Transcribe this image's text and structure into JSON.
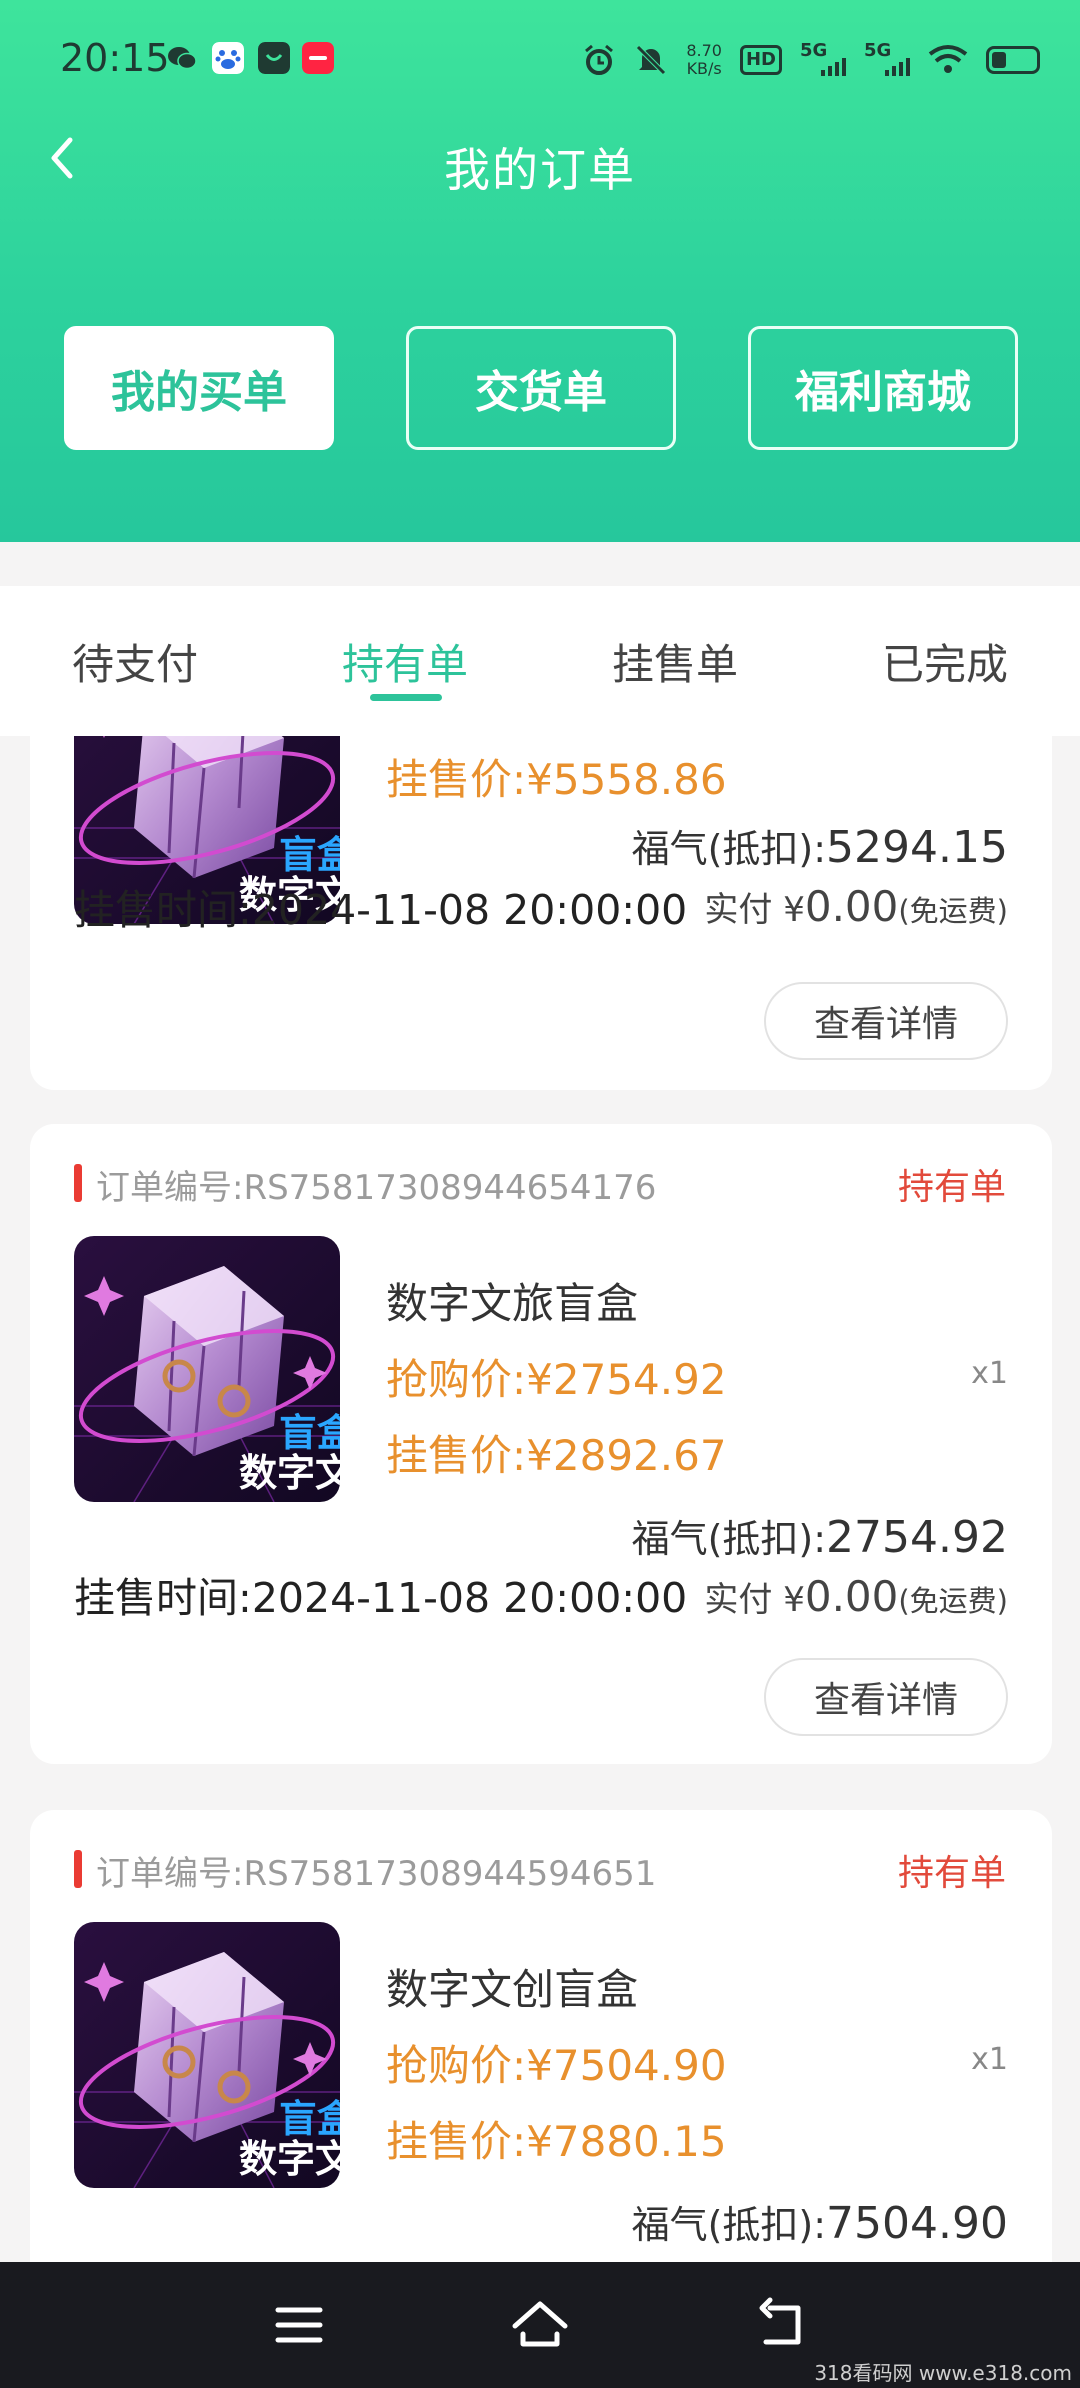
{
  "status_bar": {
    "time": "20:15",
    "net_speed_value": "8.70",
    "net_speed_unit": "KB/s",
    "hd_label": "HD",
    "sim1_label": "5G",
    "sim2_label": "5G",
    "icons": [
      "wechat-icon",
      "baidu-icon",
      "shop-icon",
      "xiaohongshu-icon",
      "alarm-icon",
      "mute-bell-icon",
      "wifi-icon",
      "battery-icon"
    ]
  },
  "header": {
    "title": "我的订单",
    "segments": [
      {
        "label": "我的买单",
        "active": true
      },
      {
        "label": "交货单",
        "active": false
      },
      {
        "label": "福利商城",
        "active": false
      }
    ]
  },
  "tabs": [
    {
      "label": "待支付",
      "active": false
    },
    {
      "label": "持有单",
      "active": true
    },
    {
      "label": "挂售单",
      "active": false
    },
    {
      "label": "已完成",
      "active": false
    }
  ],
  "orders": [
    {
      "sell_price": "挂售价:¥5558.86",
      "blessing_label": "福气(抵扣):",
      "blessing_value": "5294.15",
      "sell_time": "挂售时间:2024-11-08 20:00:00",
      "paid_label": "实付",
      "paid_currency": "¥",
      "paid_value": "0.00",
      "paid_note": "(免运费)",
      "detail_button": "查看详情"
    },
    {
      "order_no": "订单编号:RS75817308944654176",
      "status": "持有单",
      "product_name": "数字文旅盲盒",
      "buy_price": "抢购价:¥2754.92",
      "sell_price": "挂售价:¥2892.67",
      "quantity": "x1",
      "blessing_label": "福气(抵扣):",
      "blessing_value": "2754.92",
      "sell_time": "挂售时间:2024-11-08 20:00:00",
      "paid_label": "实付",
      "paid_currency": "¥",
      "paid_value": "0.00",
      "paid_note": "(免运费)",
      "detail_button": "查看详情"
    },
    {
      "order_no": "订单编号:RS75817308944594651",
      "status": "持有单",
      "product_name": "数字文创盲盒",
      "buy_price": "抢购价:¥7504.90",
      "sell_price": "挂售价:¥7880.15",
      "quantity": "x1",
      "blessing_label": "福气(抵扣):",
      "blessing_value": "7504.90"
    }
  ],
  "thumbnail_text": "数字文",
  "thumbnail_text2": "盲盒",
  "watermark": "318看码网 www.e318.com",
  "colors": {
    "brand_green": "#2dc39a",
    "price_orange": "#e8902d",
    "status_red": "#e24a3b"
  }
}
